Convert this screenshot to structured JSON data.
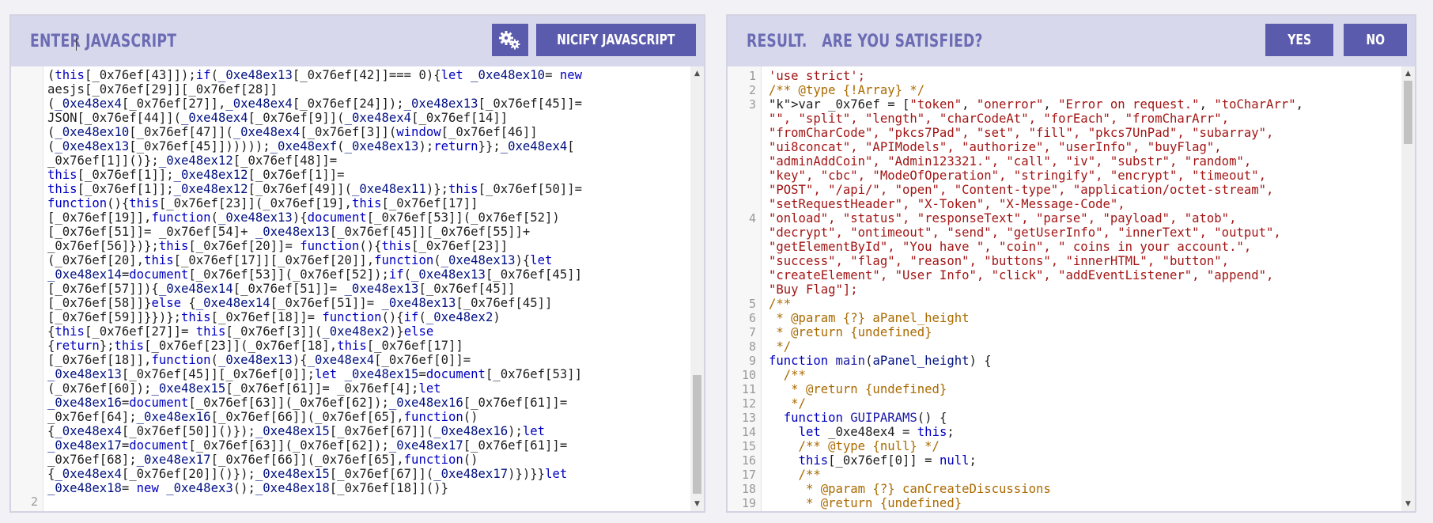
{
  "left_panel": {
    "title": "ENTER JAVASCRIPT",
    "settings_icon": "gears-icon",
    "nicify_label": "NICIFY JAVASCRIPT",
    "line_numbers": [
      "2"
    ],
    "code_lines": [
      "(this[_0x76ef[43]]);if(_0xe48ex13[_0x76ef[42]]=== 0){let _0xe48ex10= new",
      "aesjs[_0x76ef[29]][_0x76ef[28]]",
      "(_0xe48ex4[_0x76ef[27]],_0xe48ex4[_0x76ef[24]]);_0xe48ex13[_0x76ef[45]]=",
      "JSON[_0x76ef[44]](_0xe48ex4[_0x76ef[9]](_0xe48ex4[_0x76ef[14]]",
      "(_0xe48ex10[_0x76ef[47]](_0xe48ex4[_0x76ef[3]](window[_0x76ef[46]]",
      "(_0xe48ex13[_0x76ef[45]])))));_0xe48exf(_0xe48ex13);return}};_0xe48ex4[",
      "_0x76ef[1]]()};_0xe48ex12[_0x76ef[48]]=",
      "this[_0x76ef[1]];_0xe48ex12[_0x76ef[1]]=",
      "this[_0x76ef[1]];_0xe48ex12[_0x76ef[49]](_0xe48ex11)};this[_0x76ef[50]]=",
      "function(){this[_0x76ef[23]](_0x76ef[19],this[_0x76ef[17]]",
      "[_0x76ef[19]],function(_0xe48ex13){document[_0x76ef[53]](_0x76ef[52])",
      "[_0x76ef[51]]= _0x76ef[54]+ _0xe48ex13[_0x76ef[45]][_0x76ef[55]]+",
      "_0x76ef[56]})};this[_0x76ef[20]]= function(){this[_0x76ef[23]]",
      "(_0x76ef[20],this[_0x76ef[17]][_0x76ef[20]],function(_0xe48ex13){let",
      "_0xe48ex14=document[_0x76ef[53]](_0x76ef[52]);if(_0xe48ex13[_0x76ef[45]]",
      "[_0x76ef[57]]){_0xe48ex14[_0x76ef[51]]= _0xe48ex13[_0x76ef[45]]",
      "[_0x76ef[58]]}else {_0xe48ex14[_0x76ef[51]]= _0xe48ex13[_0x76ef[45]]",
      "[_0x76ef[59]]}})};this[_0x76ef[18]]= function(){if(_0xe48ex2)",
      "{this[_0x76ef[27]]= this[_0x76ef[3]](_0xe48ex2)}else",
      "{return};this[_0x76ef[23]](_0x76ef[18],this[_0x76ef[17]]",
      "[_0x76ef[18]],function(_0xe48ex13){_0xe48ex4[_0x76ef[0]]=",
      "_0xe48ex13[_0x76ef[45]][_0x76ef[0]];let _0xe48ex15=document[_0x76ef[53]]",
      "(_0x76ef[60]);_0xe48ex15[_0x76ef[61]]= _0x76ef[4];let",
      "_0xe48ex16=document[_0x76ef[63]](_0x76ef[62]);_0xe48ex16[_0x76ef[61]]=",
      "_0x76ef[64];_0xe48ex16[_0x76ef[66]](_0x76ef[65],function()",
      "{_0xe48ex4[_0x76ef[50]]()});_0xe48ex15[_0x76ef[67]](_0xe48ex16);let",
      "_0xe48ex17=document[_0x76ef[63]](_0x76ef[62]);_0xe48ex17[_0x76ef[61]]=",
      "_0x76ef[68];_0xe48ex17[_0x76ef[66]](_0x76ef[65],function()",
      "{_0xe48ex4[_0x76ef[20]]()});_0xe48ex15[_0x76ef[67]](_0xe48ex17)})}}let",
      "_0xe48ex18= new _0xe48ex3();_0xe48ex18[_0x76ef[18]]()}"
    ]
  },
  "right_panel": {
    "title": "RESULT.   ARE YOU SATISFIED?",
    "yes_label": "YES",
    "no_label": "NO",
    "lines": [
      {
        "n": "1",
        "t": "'use strict';",
        "k": "s"
      },
      {
        "n": "2",
        "t": "/** @type {!Array} */",
        "k": "c"
      },
      {
        "n": "3",
        "t": "var _0x76ef = [\"token\", \"onerror\", \"Error on request.\", \"toCharArr\",",
        "k": "mix"
      },
      {
        "n": "",
        "t": "\"\", \"split\", \"length\", \"charCodeAt\", \"forEach\", \"fromCharArr\",",
        "k": "s"
      },
      {
        "n": "",
        "t": "\"fromCharCode\", \"pkcs7Pad\", \"set\", \"fill\", \"pkcs7UnPad\", \"subarray\",",
        "k": "s"
      },
      {
        "n": "",
        "t": "\"ui8concat\", \"APIModels\", \"authorize\", \"userInfo\", \"buyFlag\",",
        "k": "s"
      },
      {
        "n": "",
        "t": "\"adminAddCoin\", \"Admin123321.\", \"call\", \"iv\", \"substr\", \"random\",",
        "k": "s"
      },
      {
        "n": "",
        "t": "\"key\", \"cbc\", \"ModeOfOperation\", \"stringify\", \"encrypt\", \"timeout\",",
        "k": "s"
      },
      {
        "n": "",
        "t": "\"POST\", \"/api/\", \"open\", \"Content-type\", \"application/octet-stream\",",
        "k": "s"
      },
      {
        "n": "",
        "t": "\"setRequestHeader\", \"X-Token\", \"X-Message-Code\",",
        "k": "s"
      },
      {
        "n": "4",
        "t": "\"onload\", \"status\", \"responseText\", \"parse\", \"payload\", \"atob\",",
        "k": "s"
      },
      {
        "n": "",
        "t": "\"decrypt\", \"ontimeout\", \"send\", \"getUserInfo\", \"innerText\", \"output\",",
        "k": "s"
      },
      {
        "n": "",
        "t": "\"getElementById\", \"You have \", \"coin\", \" coins in your account.\",",
        "k": "s"
      },
      {
        "n": "",
        "t": "\"success\", \"flag\", \"reason\", \"buttons\", \"innerHTML\", \"button\",",
        "k": "s"
      },
      {
        "n": "",
        "t": "\"createElement\", \"User Info\", \"click\", \"addEventListener\", \"append\",",
        "k": "s"
      },
      {
        "n": "",
        "t": "\"Buy Flag\"];",
        "k": "s"
      },
      {
        "n": "5",
        "t": "/**",
        "k": "c"
      },
      {
        "n": "6",
        "t": " * @param {?} aPanel_height",
        "k": "c"
      },
      {
        "n": "7",
        "t": " * @return {undefined}",
        "k": "c"
      },
      {
        "n": "8",
        "t": " */",
        "k": "c"
      },
      {
        "n": "9",
        "t": "function main(aPanel_height) {",
        "k": "fn"
      },
      {
        "n": "10",
        "t": "  /**",
        "k": "c"
      },
      {
        "n": "11",
        "t": "   * @return {undefined}",
        "k": "c"
      },
      {
        "n": "12",
        "t": "   */",
        "k": "c"
      },
      {
        "n": "13",
        "t": "  function GUIPARAMS() {",
        "k": "fn"
      },
      {
        "n": "14",
        "t": "    let _0xe48ex4 = this;",
        "k": "p"
      },
      {
        "n": "15",
        "t": "    /** @type {null} */",
        "k": "c"
      },
      {
        "n": "16",
        "t": "    this[_0x76ef[0]] = null;",
        "k": "p"
      },
      {
        "n": "17",
        "t": "    /**",
        "k": "c"
      },
      {
        "n": "18",
        "t": "     * @param {?} canCreateDiscussions",
        "k": "c"
      },
      {
        "n": "19",
        "t": "     * @return {undefined}",
        "k": "c"
      }
    ]
  }
}
